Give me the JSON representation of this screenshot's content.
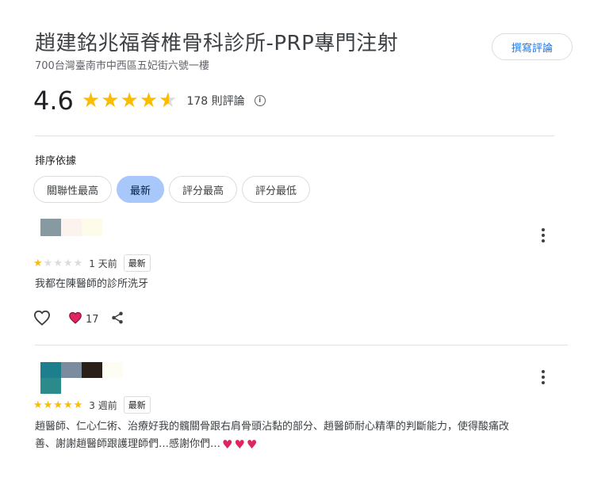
{
  "header": {
    "title": "趙建銘兆福脊椎骨科診所-PRP專門注射",
    "address": "700台灣臺南市中西區五妃街六號一樓",
    "write_review_label": "撰寫評論"
  },
  "summary": {
    "rating": "4.6",
    "rating_value": 4.6,
    "review_count": "178 則評論",
    "info_icon": "i"
  },
  "sort": {
    "label": "排序依據",
    "options": [
      "關聯性最高",
      "最新",
      "評分最高",
      "評分最低"
    ],
    "selected": "最新"
  },
  "reviews": [
    {
      "rating": 1,
      "time": "1 天前",
      "tag": "最新",
      "text": "我都在陳醫師的診所洗牙",
      "like_count": "17"
    },
    {
      "rating": 5,
      "time": "3 週前",
      "tag": "最新",
      "text_line1": "趙醫師、仁心仁術、治療好我的髖關骨跟右肩骨頭沾黏的部分、趙醫師耐心精準的判斷能力，使得酸痛改",
      "text_line2": "善、謝謝趙醫師跟護理師們…感謝你們…"
    }
  ],
  "colors": {
    "star": "#fbbc04",
    "star_empty": "#dadce0",
    "chip_active": "#a8c7fa",
    "link_blue": "#1a73e8",
    "heart": "#e0245e"
  },
  "icons": [
    "info-icon",
    "star-icon",
    "more-vert-icon",
    "heart-outline-icon",
    "heart-filled-icon",
    "share-icon"
  ]
}
